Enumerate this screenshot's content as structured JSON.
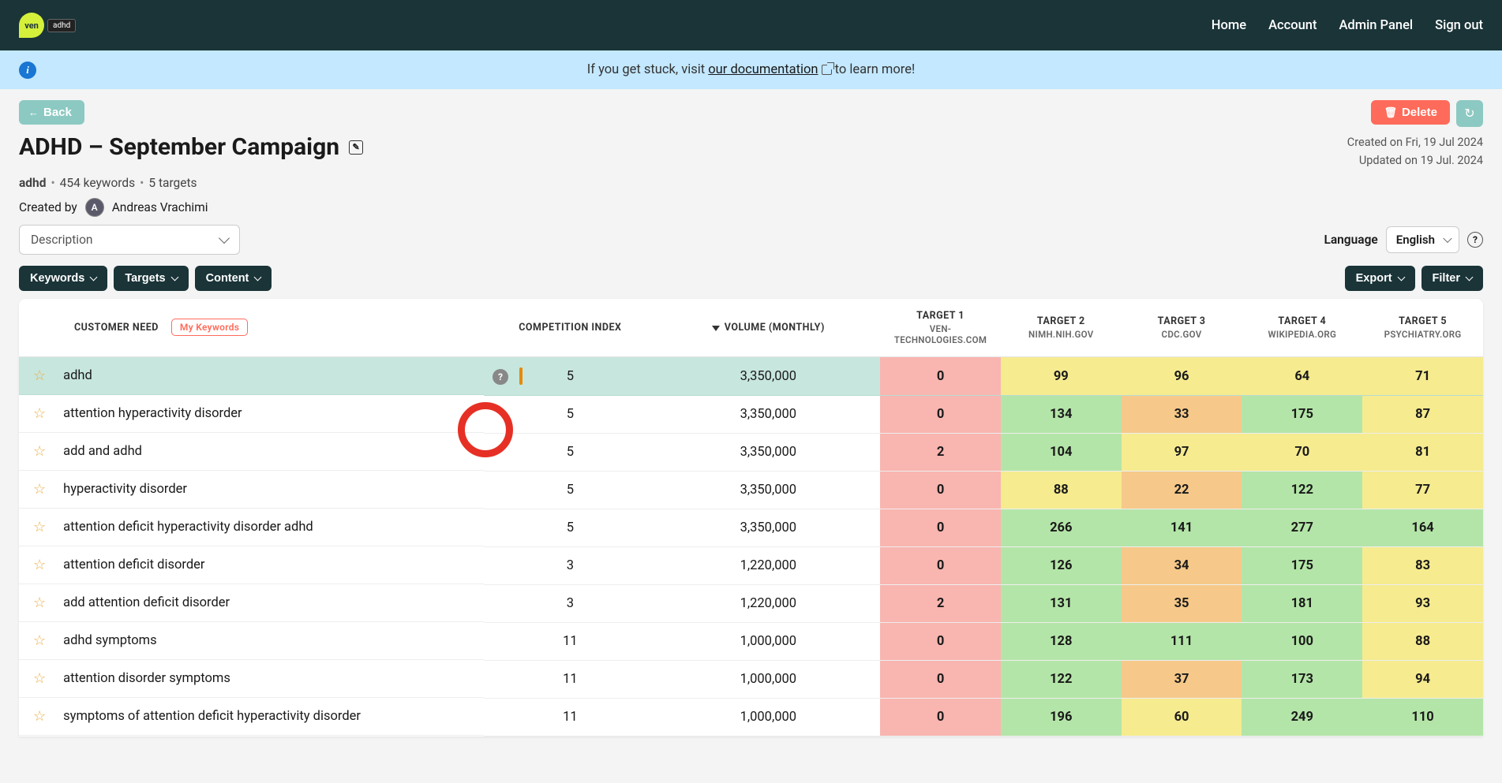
{
  "nav": {
    "home": "Home",
    "account": "Account",
    "admin": "Admin Panel",
    "signout": "Sign out"
  },
  "logo": {
    "text": "ven",
    "tag": "adhd"
  },
  "banner": {
    "prefix": "If you get stuck, visit ",
    "link": "our documentation",
    "suffix": " to learn more!"
  },
  "buttons": {
    "back": "Back",
    "delete": "Delete",
    "keywords": "Keywords",
    "targets": "Targets",
    "content": "Content",
    "export": "Export",
    "filter": "Filter"
  },
  "title": "ADHD – September Campaign",
  "meta": {
    "created": "Created on Fri, 19 Jul 2024",
    "updated": "Updated on 19 Jul. 2024"
  },
  "subtitle": {
    "tag": "adhd",
    "keywords": "454 keywords",
    "targets": "5 targets"
  },
  "author": {
    "label": "Created by",
    "initial": "A",
    "name": "Andreas Vrachimi"
  },
  "desc": {
    "label": "Description"
  },
  "lang": {
    "label": "Language",
    "value": "English"
  },
  "columns": {
    "need": "CUSTOMER NEED",
    "mykw": "My Keywords",
    "ci": "COMPETITION INDEX",
    "vol": "VOLUME (MONTHLY)",
    "t1": "TARGET 1",
    "t1s": "VEN-TECHNOLOGIES.COM",
    "t2": "TARGET 2",
    "t2s": "NIMH.NIH.GOV",
    "t3": "TARGET 3",
    "t3s": "CDC.GOV",
    "t4": "TARGET 4",
    "t4s": "WIKIPEDIA.ORG",
    "t5": "TARGET 5",
    "t5s": "PSYCHIATRY.ORG"
  },
  "rows": [
    {
      "kw": "adhd",
      "ci": "5",
      "vol": "3,350,000",
      "t": [
        "0",
        "99",
        "96",
        "64",
        "71"
      ],
      "cls": [
        "c-red",
        "c-yellow",
        "c-yellow",
        "c-yellow",
        "c-yellow"
      ],
      "sel": true
    },
    {
      "kw": "attention hyperactivity disorder",
      "ci": "5",
      "vol": "3,350,000",
      "t": [
        "0",
        "134",
        "33",
        "175",
        "87"
      ],
      "cls": [
        "c-red",
        "c-green",
        "c-orange",
        "c-green",
        "c-yellow"
      ]
    },
    {
      "kw": "add and adhd",
      "ci": "5",
      "vol": "3,350,000",
      "t": [
        "2",
        "104",
        "97",
        "70",
        "81"
      ],
      "cls": [
        "c-red",
        "c-green",
        "c-yellow",
        "c-yellow",
        "c-yellow"
      ]
    },
    {
      "kw": "hyperactivity disorder",
      "ci": "5",
      "vol": "3,350,000",
      "t": [
        "0",
        "88",
        "22",
        "122",
        "77"
      ],
      "cls": [
        "c-red",
        "c-yellow",
        "c-orange",
        "c-green",
        "c-yellow"
      ]
    },
    {
      "kw": "attention deficit hyperactivity disorder adhd",
      "ci": "5",
      "vol": "3,350,000",
      "t": [
        "0",
        "266",
        "141",
        "277",
        "164"
      ],
      "cls": [
        "c-red",
        "c-green",
        "c-green",
        "c-green",
        "c-green"
      ]
    },
    {
      "kw": "attention deficit disorder",
      "ci": "3",
      "vol": "1,220,000",
      "t": [
        "0",
        "126",
        "34",
        "175",
        "83"
      ],
      "cls": [
        "c-red",
        "c-green",
        "c-orange",
        "c-green",
        "c-yellow"
      ]
    },
    {
      "kw": "add attention deficit disorder",
      "ci": "3",
      "vol": "1,220,000",
      "t": [
        "2",
        "131",
        "35",
        "181",
        "93"
      ],
      "cls": [
        "c-red",
        "c-green",
        "c-orange",
        "c-green",
        "c-yellow"
      ]
    },
    {
      "kw": "adhd symptoms",
      "ci": "11",
      "vol": "1,000,000",
      "t": [
        "0",
        "128",
        "111",
        "100",
        "88"
      ],
      "cls": [
        "c-red",
        "c-green",
        "c-green",
        "c-green",
        "c-yellow"
      ]
    },
    {
      "kw": "attention disorder symptoms",
      "ci": "11",
      "vol": "1,000,000",
      "t": [
        "0",
        "122",
        "37",
        "173",
        "94"
      ],
      "cls": [
        "c-red",
        "c-green",
        "c-orange",
        "c-green",
        "c-yellow"
      ]
    },
    {
      "kw": "symptoms of attention deficit hyperactivity disorder",
      "ci": "11",
      "vol": "1,000,000",
      "t": [
        "0",
        "196",
        "60",
        "249",
        "110"
      ],
      "cls": [
        "c-red",
        "c-green",
        "c-yellow",
        "c-green",
        "c-green"
      ]
    }
  ]
}
